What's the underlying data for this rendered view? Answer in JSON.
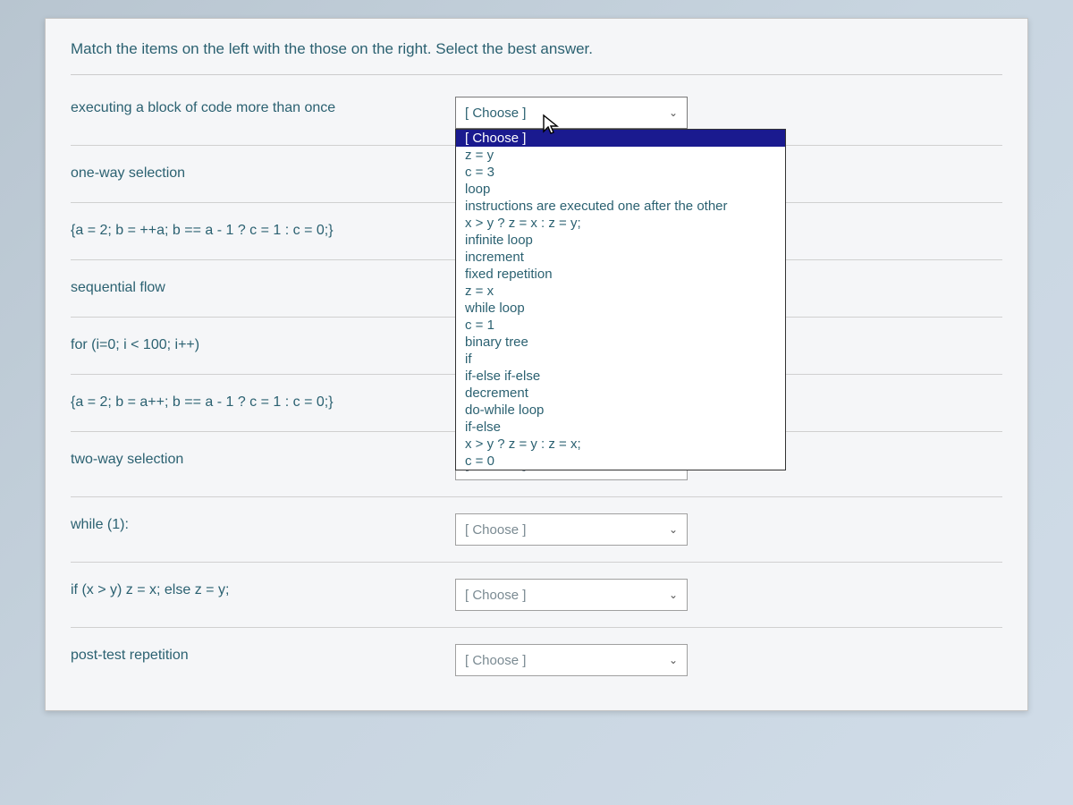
{
  "instruction": "Match the items on the left with the those on the right. Select the best answer.",
  "choose_placeholder": "[ Choose ]",
  "prompts": [
    "executing a block of code more than once",
    "one-way selection",
    "{a = 2; b = ++a; b == a - 1 ? c = 1 : c = 0;}",
    "sequential flow",
    "for (i=0; i < 100; i++)",
    "{a = 2; b = a++; b == a - 1 ? c = 1 : c = 0;}",
    "two-way selection",
    "while (1):",
    "if (x > y) z = x; else z = y;",
    "post-test repetition"
  ],
  "dropdown_options": [
    "[ Choose ]",
    "z = y",
    "c = 3",
    "loop",
    "instructions are executed one after the other",
    "x > y ? z = x : z = y;",
    "infinite loop",
    "increment",
    "fixed repetition",
    "z = x",
    "while loop",
    "c = 1",
    "binary tree",
    "if",
    "if-else if-else",
    "decrement",
    "do-while loop",
    "if-else",
    "x > y ? z = y : z = x;",
    "c = 0"
  ],
  "open_dropdown_row": 0,
  "selected_option_index": 0
}
